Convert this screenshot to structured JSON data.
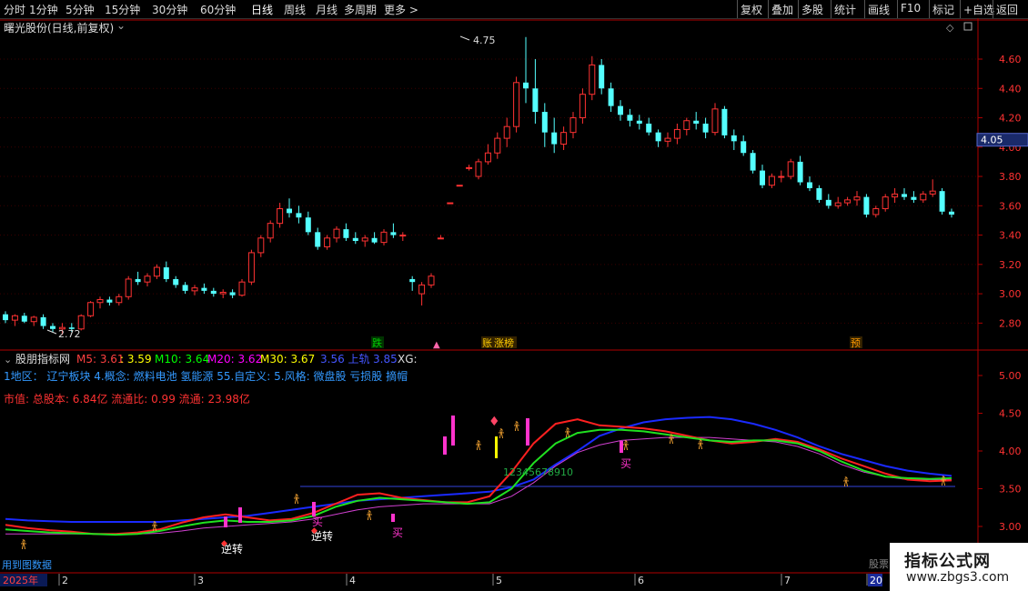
{
  "toolbar": {
    "periods": [
      "分时",
      "1分钟",
      "5分钟",
      "15分钟",
      "30分钟",
      "60分钟",
      "日线",
      "周线",
      "月线",
      "多周期",
      "更多 >"
    ],
    "right_buttons": [
      "复权",
      "叠加",
      "多股",
      "统计",
      "画线",
      "F10",
      "标记",
      "+自选",
      "返回"
    ]
  },
  "chart_header": {
    "stock_title": "曙光股份(日线,前复权)",
    "price_high_label": "4.75",
    "price_low_label": "2.72",
    "current_price": "4.05",
    "markers": [
      "跌",
      "账",
      "涨榜",
      "预"
    ]
  },
  "indicator_header": {
    "name": "股朋指标网",
    "m5": "M5: 3.61",
    "val2": ": 3.59",
    "m10": "M10: 3.64",
    "m20": "M20: 3.62",
    "m30": "M30: 3.67",
    "upper": "3.56 上轨",
    "upper2": "3.85",
    "xg": "XG:",
    "line2": "1地区： 辽宁板块   4.概念: 燃料电池 氢能源  55.自定义:   5.风格:  微盘股 亏损股 摘帽",
    "line3": "市值: 总股本: 6.84亿 流通比: 0.99 流通: 23.98亿"
  },
  "signals": {
    "buy": "买",
    "reverse": "逆转",
    "count_label": "12345678910"
  },
  "bottom": {
    "footer_left": "用到图数据",
    "year_label": "2025年",
    "months": [
      "2",
      "3",
      "4",
      "5",
      "6",
      "7",
      "20"
    ],
    "footer_right_fragment": "股票"
  },
  "chart_data": {
    "type": "candlestick",
    "price_axis_ticks": [
      "4.60",
      "4.40",
      "4.20",
      "4.00",
      "3.80",
      "3.60",
      "3.40",
      "3.20",
      "3.00",
      "2.80"
    ],
    "indicator_axis_ticks": [
      "5.00",
      "4.50",
      "4.00",
      "3.50",
      "3.00"
    ],
    "ohlc": [
      [
        2.86,
        2.88,
        2.8,
        2.82
      ],
      [
        2.82,
        2.86,
        2.78,
        2.85
      ],
      [
        2.85,
        2.87,
        2.8,
        2.81
      ],
      [
        2.81,
        2.85,
        2.78,
        2.84
      ],
      [
        2.84,
        2.86,
        2.76,
        2.78
      ],
      [
        2.78,
        2.8,
        2.74,
        2.76
      ],
      [
        2.76,
        2.8,
        2.72,
        2.77
      ],
      [
        2.77,
        2.8,
        2.74,
        2.76
      ],
      [
        2.76,
        2.86,
        2.75,
        2.85
      ],
      [
        2.85,
        2.95,
        2.84,
        2.94
      ],
      [
        2.94,
        2.98,
        2.9,
        2.96
      ],
      [
        2.96,
        2.98,
        2.92,
        2.94
      ],
      [
        2.94,
        3.0,
        2.92,
        2.98
      ],
      [
        2.98,
        3.12,
        2.96,
        3.1
      ],
      [
        3.1,
        3.15,
        3.06,
        3.08
      ],
      [
        3.08,
        3.14,
        3.05,
        3.12
      ],
      [
        3.12,
        3.2,
        3.1,
        3.18
      ],
      [
        3.18,
        3.22,
        3.08,
        3.1
      ],
      [
        3.1,
        3.12,
        3.04,
        3.06
      ],
      [
        3.06,
        3.08,
        3.0,
        3.02
      ],
      [
        3.02,
        3.06,
        2.99,
        3.04
      ],
      [
        3.04,
        3.07,
        3.0,
        3.02
      ],
      [
        3.02,
        3.04,
        2.98,
        3.0
      ],
      [
        3.0,
        3.03,
        2.97,
        3.01
      ],
      [
        3.01,
        3.03,
        2.97,
        2.99
      ],
      [
        2.99,
        3.1,
        2.98,
        3.08
      ],
      [
        3.08,
        3.3,
        3.06,
        3.28
      ],
      [
        3.28,
        3.4,
        3.25,
        3.38
      ],
      [
        3.38,
        3.5,
        3.35,
        3.48
      ],
      [
        3.48,
        3.62,
        3.45,
        3.58
      ],
      [
        3.58,
        3.65,
        3.52,
        3.55
      ],
      [
        3.55,
        3.6,
        3.48,
        3.52
      ],
      [
        3.52,
        3.56,
        3.4,
        3.42
      ],
      [
        3.42,
        3.45,
        3.3,
        3.32
      ],
      [
        3.32,
        3.4,
        3.3,
        3.38
      ],
      [
        3.38,
        3.46,
        3.35,
        3.44
      ],
      [
        3.44,
        3.48,
        3.36,
        3.38
      ],
      [
        3.38,
        3.42,
        3.34,
        3.36
      ],
      [
        3.36,
        3.4,
        3.32,
        3.38
      ],
      [
        3.38,
        3.42,
        3.34,
        3.35
      ],
      [
        3.35,
        3.44,
        3.33,
        3.42
      ],
      [
        3.42,
        3.48,
        3.38,
        3.4
      ],
      [
        3.4,
        3.42,
        3.36,
        3.4
      ],
      [
        3.1,
        3.12,
        3.02,
        3.08
      ],
      [
        3.0,
        3.08,
        2.92,
        3.06
      ],
      [
        3.06,
        3.14,
        3.04,
        3.12
      ],
      [
        3.38,
        3.4,
        3.38,
        3.38
      ],
      [
        3.62,
        3.62,
        3.62,
        3.62
      ],
      [
        3.74,
        3.74,
        3.74,
        3.74
      ],
      [
        3.86,
        3.88,
        3.84,
        3.86
      ],
      [
        3.8,
        3.92,
        3.78,
        3.9
      ],
      [
        3.9,
        4.02,
        3.88,
        3.96
      ],
      [
        3.96,
        4.1,
        3.92,
        4.06
      ],
      [
        4.06,
        4.2,
        4.0,
        4.14
      ],
      [
        4.14,
        4.48,
        4.1,
        4.44
      ],
      [
        4.44,
        4.75,
        4.3,
        4.4
      ],
      [
        4.4,
        4.6,
        4.16,
        4.24
      ],
      [
        4.24,
        4.3,
        4.0,
        4.1
      ],
      [
        4.1,
        4.2,
        3.96,
        4.02
      ],
      [
        4.02,
        4.14,
        3.98,
        4.1
      ],
      [
        4.1,
        4.24,
        4.06,
        4.2
      ],
      [
        4.2,
        4.4,
        4.16,
        4.36
      ],
      [
        4.36,
        4.62,
        4.32,
        4.56
      ],
      [
        4.56,
        4.6,
        4.36,
        4.4
      ],
      [
        4.4,
        4.44,
        4.24,
        4.28
      ],
      [
        4.28,
        4.32,
        4.18,
        4.22
      ],
      [
        4.22,
        4.26,
        4.14,
        4.18
      ],
      [
        4.18,
        4.22,
        4.12,
        4.16
      ],
      [
        4.16,
        4.2,
        4.08,
        4.1
      ],
      [
        4.1,
        4.12,
        4.0,
        4.04
      ],
      [
        4.04,
        4.1,
        4.0,
        4.06
      ],
      [
        4.06,
        4.16,
        4.02,
        4.12
      ],
      [
        4.12,
        4.2,
        4.08,
        4.18
      ],
      [
        4.18,
        4.24,
        4.12,
        4.16
      ],
      [
        4.16,
        4.2,
        4.06,
        4.1
      ],
      [
        4.1,
        4.3,
        4.08,
        4.26
      ],
      [
        4.26,
        4.28,
        4.06,
        4.08
      ],
      [
        4.08,
        4.12,
        3.98,
        4.04
      ],
      [
        4.04,
        4.08,
        3.94,
        3.96
      ],
      [
        3.96,
        3.98,
        3.82,
        3.84
      ],
      [
        3.84,
        3.88,
        3.72,
        3.74
      ],
      [
        3.74,
        3.82,
        3.72,
        3.8
      ],
      [
        3.8,
        3.84,
        3.76,
        3.8
      ],
      [
        3.8,
        3.92,
        3.78,
        3.9
      ],
      [
        3.9,
        3.94,
        3.74,
        3.76
      ],
      [
        3.76,
        3.8,
        3.7,
        3.72
      ],
      [
        3.72,
        3.74,
        3.62,
        3.64
      ],
      [
        3.64,
        3.68,
        3.58,
        3.6
      ],
      [
        3.6,
        3.66,
        3.58,
        3.62
      ],
      [
        3.62,
        3.66,
        3.6,
        3.64
      ],
      [
        3.64,
        3.7,
        3.6,
        3.66
      ],
      [
        3.66,
        3.68,
        3.52,
        3.54
      ],
      [
        3.54,
        3.6,
        3.52,
        3.58
      ],
      [
        3.58,
        3.68,
        3.56,
        3.66
      ],
      [
        3.66,
        3.72,
        3.62,
        3.68
      ],
      [
        3.68,
        3.72,
        3.64,
        3.66
      ],
      [
        3.66,
        3.7,
        3.62,
        3.64
      ],
      [
        3.64,
        3.7,
        3.62,
        3.68
      ],
      [
        3.68,
        3.78,
        3.66,
        3.7
      ],
      [
        3.7,
        3.72,
        3.54,
        3.56
      ],
      [
        3.56,
        3.58,
        3.52,
        3.54
      ]
    ],
    "ma_lines": {
      "M5": [
        3.02,
        2.98,
        2.95,
        2.93,
        2.9,
        2.9,
        2.92,
        2.96,
        3.05,
        3.12,
        3.16,
        3.12,
        3.08,
        3.1,
        3.18,
        3.3,
        3.42,
        3.44,
        3.38,
        3.35,
        3.32,
        3.32,
        3.4,
        3.72,
        4.1,
        4.36,
        4.42,
        4.34,
        4.32,
        4.3,
        4.26,
        4.2,
        4.14,
        4.1,
        4.12,
        4.16,
        4.12,
        4.02,
        3.9,
        3.8,
        3.7,
        3.62,
        3.6,
        3.61
      ],
      "M10": [
        2.96,
        2.94,
        2.92,
        2.91,
        2.9,
        2.89,
        2.9,
        2.94,
        3.0,
        3.05,
        3.08,
        3.06,
        3.06,
        3.08,
        3.14,
        3.26,
        3.34,
        3.38,
        3.36,
        3.34,
        3.32,
        3.3,
        3.32,
        3.5,
        3.84,
        4.1,
        4.24,
        4.28,
        4.28,
        4.26,
        4.22,
        4.18,
        4.14,
        4.12,
        4.14,
        4.14,
        4.1,
        4.0,
        3.86,
        3.74,
        3.66,
        3.64,
        3.63,
        3.64
      ],
      "M20": [
        2.9,
        2.9,
        2.9,
        2.9,
        2.9,
        2.9,
        2.9,
        2.91,
        2.94,
        2.98,
        3.0,
        3.02,
        3.04,
        3.06,
        3.1,
        3.16,
        3.22,
        3.26,
        3.28,
        3.3,
        3.3,
        3.3,
        3.3,
        3.4,
        3.58,
        3.8,
        3.98,
        4.08,
        4.14,
        4.16,
        4.18,
        4.18,
        4.18,
        4.16,
        4.14,
        4.12,
        4.06,
        3.96,
        3.82,
        3.72,
        3.66,
        3.62,
        3.62,
        3.62
      ],
      "M30": [
        3.1,
        3.08,
        3.07,
        3.06,
        3.06,
        3.06,
        3.06,
        3.06,
        3.08,
        3.1,
        3.12,
        3.14,
        3.18,
        3.22,
        3.26,
        3.3,
        3.34,
        3.36,
        3.38,
        3.4,
        3.42,
        3.44,
        3.46,
        3.52,
        3.62,
        3.82,
        4.0,
        4.2,
        4.3,
        4.38,
        4.42,
        4.44,
        4.45,
        4.42,
        4.36,
        4.28,
        4.18,
        4.06,
        3.96,
        3.88,
        3.8,
        3.74,
        3.7,
        3.67
      ]
    }
  }
}
